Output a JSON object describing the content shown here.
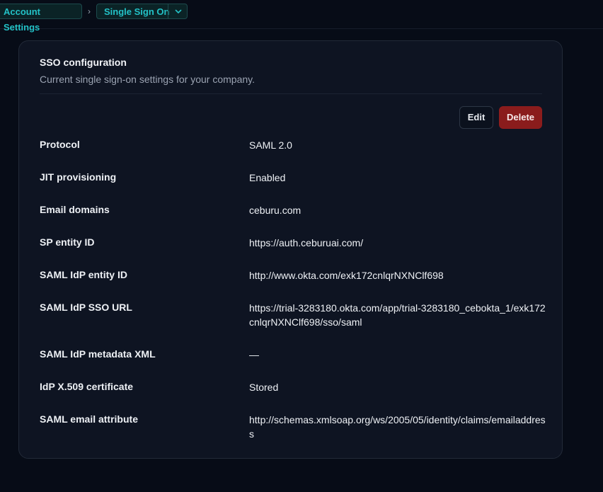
{
  "breadcrumb": {
    "parent_label": "Account Settings",
    "separator": "›",
    "current_label": "Single Sign On",
    "dropdown_icon": "chevron-down-icon"
  },
  "card": {
    "title": "SSO configuration",
    "subtitle": "Current single sign-on settings for your company.",
    "edit_label": "Edit",
    "delete_label": "Delete"
  },
  "rows": [
    {
      "label": "Protocol",
      "value": "SAML 2.0"
    },
    {
      "label": "JIT provisioning",
      "value": "Enabled"
    },
    {
      "label": "Email domains",
      "value": "ceburu.com"
    },
    {
      "label": "SP entity ID",
      "value": "https://auth.ceburuai.com/"
    },
    {
      "label": "SAML IdP entity ID",
      "value": "http://www.okta.com/exk172cnlqrNXNClf698"
    },
    {
      "label": "SAML IdP SSO URL",
      "value": "https://trial-3283180.okta.com/app/trial-3283180_cebokta_1/exk172cnlqrNXNClf698/sso/saml"
    },
    {
      "label": "SAML IdP metadata XML",
      "value": "—"
    },
    {
      "label": "IdP X.509 certificate",
      "value": "Stored"
    },
    {
      "label": "SAML email attribute",
      "value": "http://schemas.xmlsoap.org/ws/2005/05/identity/claims/emailaddress"
    }
  ],
  "colors": {
    "background": "#070c17",
    "card": "#0e1422",
    "accent": "#23c2c7",
    "danger": "#8a1c1c"
  }
}
